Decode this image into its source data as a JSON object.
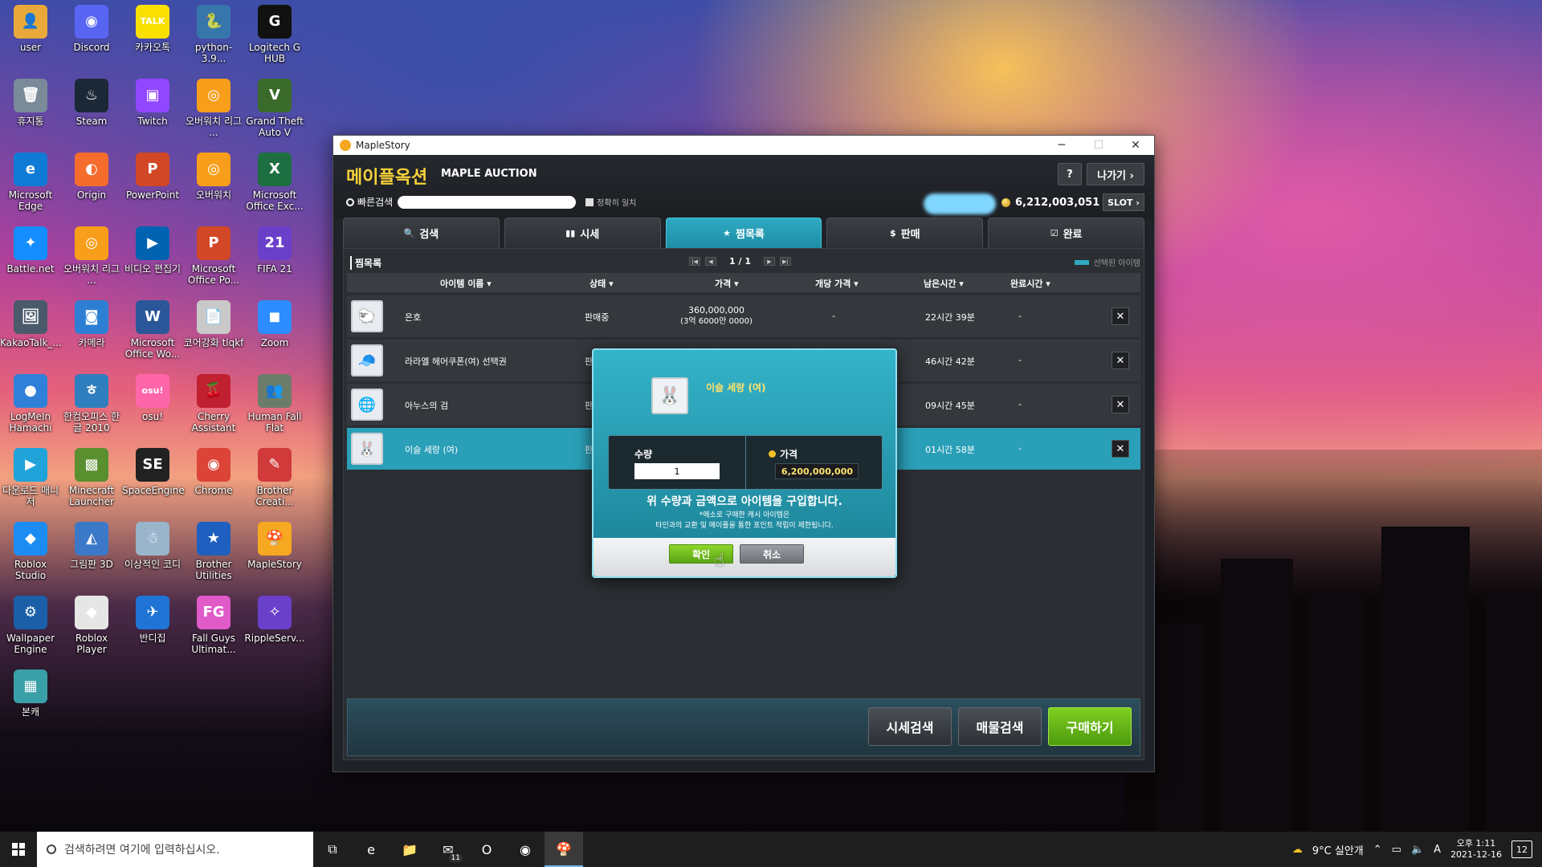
{
  "desktop": {
    "icons": [
      {
        "label": "user",
        "glyph": "👤",
        "color": "#e8a93a"
      },
      {
        "label": "Discord",
        "glyph": "◉",
        "color": "#5865f2"
      },
      {
        "label": "카카오톡",
        "glyph": "TALK",
        "color": "#f9e000"
      },
      {
        "label": "python-3.9...",
        "glyph": "🐍",
        "color": "#3776ab"
      },
      {
        "label": "Logitech G HUB",
        "glyph": "G",
        "color": "#111111"
      },
      {
        "label": "휴지통",
        "glyph": "🗑",
        "color": "#7a8a99"
      },
      {
        "label": "Steam",
        "glyph": "♨",
        "color": "#1b2838"
      },
      {
        "label": "Twitch",
        "glyph": "▣",
        "color": "#9146ff"
      },
      {
        "label": "오버워치 리그 ...",
        "glyph": "◎",
        "color": "#f99e1a"
      },
      {
        "label": "Grand Theft Auto V",
        "glyph": "V",
        "color": "#3b6b2a"
      },
      {
        "label": "Microsoft Edge",
        "glyph": "e",
        "color": "#0f7bd6"
      },
      {
        "label": "Origin",
        "glyph": "◐",
        "color": "#f56c2d"
      },
      {
        "label": "PowerPoint",
        "glyph": "P",
        "color": "#d24726"
      },
      {
        "label": "오버워치",
        "glyph": "◎",
        "color": "#f99e1a"
      },
      {
        "label": "Microsoft Office Exc...",
        "glyph": "X",
        "color": "#1d6f42"
      },
      {
        "label": "Battle.net",
        "glyph": "✦",
        "color": "#148eff"
      },
      {
        "label": "오버워치 리그 ...",
        "glyph": "◎",
        "color": "#f99e1a"
      },
      {
        "label": "비디오 편집기",
        "glyph": "▶",
        "color": "#0063b1"
      },
      {
        "label": "Microsoft Office Po...",
        "glyph": "P",
        "color": "#d24726"
      },
      {
        "label": "FIFA 21",
        "glyph": "21",
        "color": "#6a3fc9"
      },
      {
        "label": "KakaoTalk_...",
        "glyph": "🖼",
        "color": "#4a5a6a"
      },
      {
        "label": "카메라",
        "glyph": "◙",
        "color": "#2d7fd3"
      },
      {
        "label": "Microsoft Office Wo...",
        "glyph": "W",
        "color": "#2b579a"
      },
      {
        "label": "코어강화 tlqkf",
        "glyph": "📄",
        "color": "#c9c9c9"
      },
      {
        "label": "Zoom",
        "glyph": "◼",
        "color": "#2d8cff"
      },
      {
        "label": "LogMeIn Hamachi",
        "glyph": "●",
        "color": "#2f80d8"
      },
      {
        "label": "한컴오피스 한글 2010",
        "glyph": "ㅎ",
        "color": "#2f7fbf"
      },
      {
        "label": "osu!",
        "glyph": "osu!",
        "color": "#ff66aa"
      },
      {
        "label": "Cherry Assistant",
        "glyph": "🍒",
        "color": "#c02030"
      },
      {
        "label": "Human Fall Flat",
        "glyph": "👥",
        "color": "#6b7d6a"
      },
      {
        "label": "다운로드 매니저",
        "glyph": "▶",
        "color": "#1fa3d9"
      },
      {
        "label": "Minecraft Launcher",
        "glyph": "▩",
        "color": "#5a8f2f"
      },
      {
        "label": "SpaceEngine",
        "glyph": "SE",
        "color": "#222222"
      },
      {
        "label": "Chrome",
        "glyph": "◉",
        "color": "#db4437"
      },
      {
        "label": "Brother Creati...",
        "glyph": "✎",
        "color": "#d03a3a"
      },
      {
        "label": "Roblox Studio",
        "glyph": "◆",
        "color": "#1c8cf2"
      },
      {
        "label": "그림판 3D",
        "glyph": "◭",
        "color": "#3c78c8"
      },
      {
        "label": "이상적인 코디",
        "glyph": "☃",
        "color": "#9ab4cc"
      },
      {
        "label": "Brother Utilities",
        "glyph": "★",
        "color": "#1f5fbf"
      },
      {
        "label": "MapleStory",
        "glyph": "🍄",
        "color": "#f6a821"
      },
      {
        "label": "Wallpaper Engine",
        "glyph": "⚙",
        "color": "#1a5fa8"
      },
      {
        "label": "Roblox Player",
        "glyph": "◆",
        "color": "#e6e6e6"
      },
      {
        "label": "반디집",
        "glyph": "✈",
        "color": "#1f74d6"
      },
      {
        "label": "Fall Guys Ultimat...",
        "glyph": "FG",
        "color": "#e05ac8"
      },
      {
        "label": "RippleServ...",
        "glyph": "✧",
        "color": "#6a3fc9"
      },
      {
        "label": "본캐",
        "glyph": "▦",
        "color": "#3aa0a8"
      }
    ]
  },
  "window": {
    "title": "MapleStory",
    "controls": {
      "minimize": "─",
      "maximize": "☐",
      "close": "✕"
    }
  },
  "auction": {
    "brand_kr": "메이플옥션",
    "brand_en": "MAPLE AUCTION",
    "help_label": "?",
    "exit_label": "나가기 ›",
    "quick_search_label": "빠른검색",
    "exact_match_label": "정확히 일치",
    "meso": "6,212,003,051",
    "slot_label": "SLOT ›",
    "tabs": [
      {
        "icon": "🔍",
        "label": "검색"
      },
      {
        "icon": "▮▮",
        "label": "시세"
      },
      {
        "icon": "★",
        "label": "찜목록"
      },
      {
        "icon": "$",
        "label": "판매"
      },
      {
        "icon": "☑",
        "label": "완료"
      }
    ],
    "active_tab": 2,
    "panel_title": "찜목록",
    "pager": {
      "first": "|◀",
      "prev": "◀",
      "page": "1 / 1",
      "next": "▶",
      "last": "▶|"
    },
    "selected_legend": "선택된 아이템",
    "columns": {
      "name": "아이템 이름 ▾",
      "status": "상태 ▾",
      "price": "가격 ▾",
      "unit_price": "개당 가격 ▾",
      "remaining": "남은시간 ▾",
      "completed": "완료시간 ▾"
    },
    "rows": [
      {
        "icon": "🐑",
        "name": "은호",
        "status": "판매중",
        "price": "360,000,000",
        "price_sub": "(3억 6000만 0000)",
        "unit_price": "-",
        "remaining": "22시간 39분",
        "completed": "-",
        "selected": false
      },
      {
        "icon": "🧢",
        "name": "라라엘 헤어쿠폰(여) 선택권",
        "status": "판",
        "price": "",
        "price_sub": "",
        "unit_price": "",
        "remaining": "46시간 42분",
        "completed": "-",
        "selected": false
      },
      {
        "icon": "🌐",
        "name": "아누스의 검",
        "status": "판",
        "price": "",
        "price_sub": "",
        "unit_price": "",
        "remaining": "09시간 45분",
        "completed": "-",
        "selected": false
      },
      {
        "icon": "🐰",
        "name": "이슬 세랑 (여)",
        "status": "판",
        "price": "",
        "price_sub": "",
        "unit_price": "",
        "remaining": "01시간 58분",
        "completed": "-",
        "selected": true
      }
    ],
    "delete_label": "✕",
    "footer": {
      "price_search": "시세검색",
      "item_search": "매물검색",
      "buy": "구매하기"
    }
  },
  "modal": {
    "item_icon": "🐰",
    "item_name": "이슬 세랑 (여)",
    "qty_label": "수량",
    "qty_value": "1",
    "price_label": "가격",
    "price_value": "6,200,000,000",
    "message": "위 수량과 금액으로 아이템을 구입합니다.",
    "note_line1": "*메소로 구매한 캐시 아이템은",
    "note_line2": "타인과의 교환 및 메이플을 통한 포인트 적립이 제한됩니다.",
    "ok_label": "확인",
    "cancel_label": "취소"
  },
  "taskbar": {
    "search_placeholder": "검색하려면 여기에 입력하십시오.",
    "apps": [
      {
        "name": "task-view",
        "glyph": "⧉"
      },
      {
        "name": "edge",
        "glyph": "e"
      },
      {
        "name": "explorer",
        "glyph": "📁"
      },
      {
        "name": "mail",
        "glyph": "✉",
        "badge": "11"
      },
      {
        "name": "office",
        "glyph": "O"
      },
      {
        "name": "app-circle",
        "glyph": "◉"
      },
      {
        "name": "maplestory",
        "glyph": "🍄"
      }
    ],
    "weather": "9°C 실안개",
    "ime": "A",
    "time": "오후 1:11",
    "date": "2021-12-16",
    "notifications": "12"
  }
}
